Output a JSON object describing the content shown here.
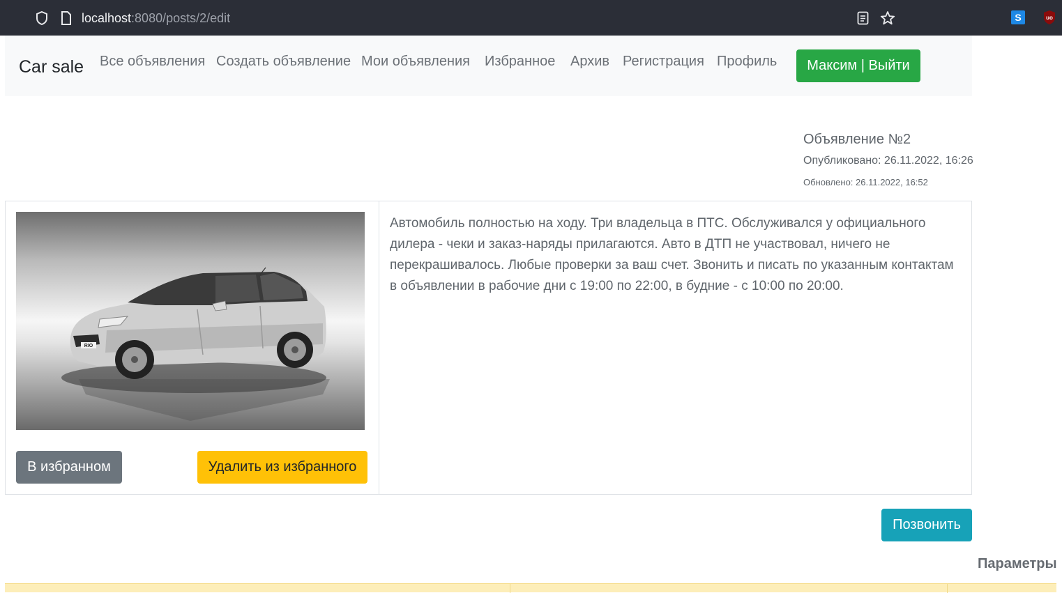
{
  "browser": {
    "url_host": "localhost",
    "url_path": ":8080/posts/2/edit"
  },
  "navbar": {
    "brand": "Car sale",
    "links": [
      "Все объявления",
      "Создать объявление",
      "Мои объявления",
      "Избранное",
      "Архив",
      "Регистрация",
      "Профиль"
    ],
    "user_button": "Максим | Выйти"
  },
  "post": {
    "title": "Объявление №2",
    "published": "Опубликовано: 26.11.2022, 16:26",
    "updated": "Обновлено: 26.11.2022, 16:52",
    "description": "Автомобиль полностью на ходу. Три владельца в ПТС. Обслуживался у официального дилера - чеки и заказ-наряды прилагаются. Авто в ДТП не участвовал, ничего не перекрашивалось. Любые проверки за ваш счет. Звонить и писать по указанным контактам в объявлении в рабочие дни с 19:00 по 22:00, в будние - с 10:00 по 20:00.",
    "photo_badge": "RIO",
    "favorite_status_button": "В избранном",
    "remove_favorite_button": "Удалить из избранного",
    "call_button": "Позвонить"
  },
  "params": {
    "heading": "Параметры"
  },
  "colors": {
    "navbar_bg": "#f8f9fa",
    "success": "#28a745",
    "secondary": "#6c757d",
    "warning": "#ffc107",
    "info": "#17a2b8"
  }
}
